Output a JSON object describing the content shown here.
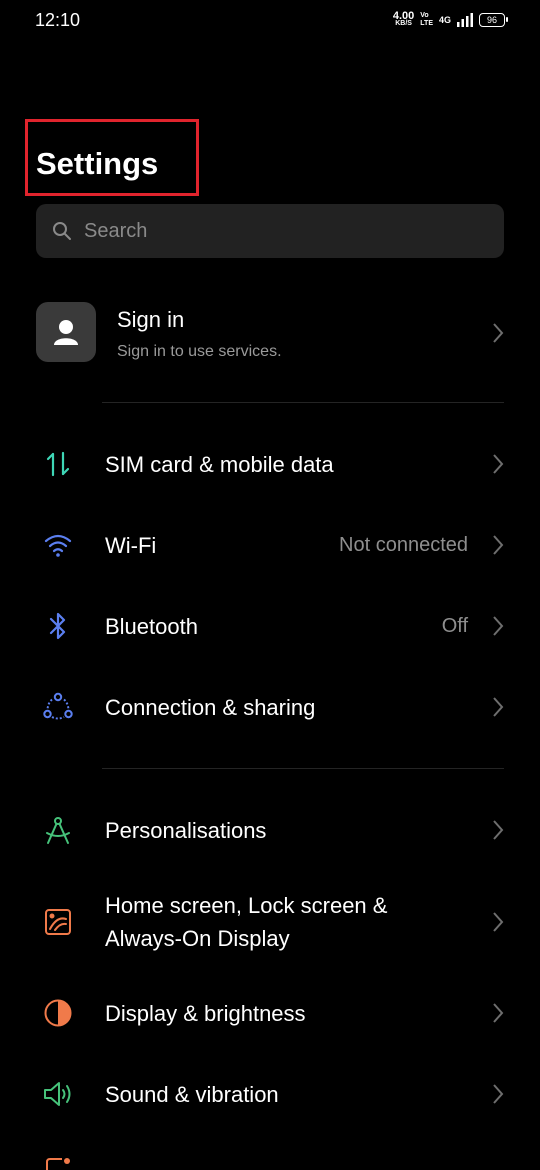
{
  "status_bar": {
    "time": "12:10",
    "net_speed_value": "4.00",
    "net_speed_unit": "KB/S",
    "volte_top": "Vo",
    "volte_bottom": "LTE",
    "network_type": "4G",
    "battery": "96"
  },
  "page_title": "Settings",
  "search": {
    "placeholder": "Search"
  },
  "sign_in": {
    "title": "Sign in",
    "subtitle": "Sign in to use services."
  },
  "items": [
    {
      "label": "SIM card & mobile data",
      "value": "",
      "icon": "sim-data-icon"
    },
    {
      "label": "Wi-Fi",
      "value": "Not connected",
      "icon": "wifi-icon"
    },
    {
      "label": "Bluetooth",
      "value": "Off",
      "icon": "bluetooth-icon"
    },
    {
      "label": "Connection & sharing",
      "value": "",
      "icon": "connection-icon"
    },
    {
      "label": "Personalisations",
      "value": "",
      "icon": "compass-icon"
    },
    {
      "label_line1": "Home screen, Lock screen &",
      "label_line2": "Always-On Display",
      "value": "",
      "icon": "home-screen-icon"
    },
    {
      "label": "Display & brightness",
      "value": "",
      "icon": "brightness-icon"
    },
    {
      "label": "Sound & vibration",
      "value": "",
      "icon": "speaker-icon"
    }
  ],
  "colors": {
    "background": "#000000",
    "highlight": "#e0242d",
    "teal": "#3ed6b6",
    "blue": "#5b7ff0",
    "orange": "#f07a4a",
    "green": "#46c27a"
  }
}
